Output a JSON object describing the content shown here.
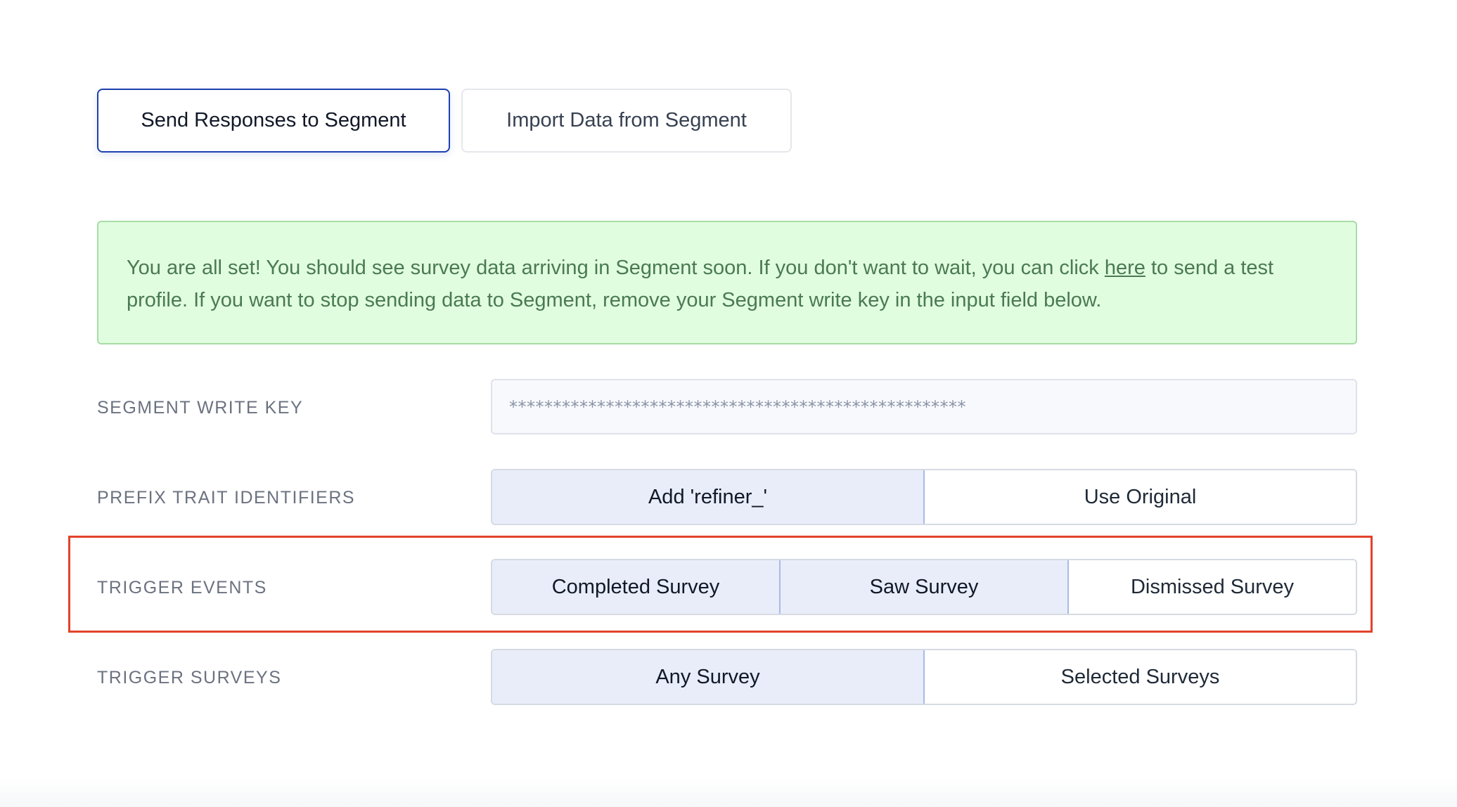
{
  "tabs": [
    {
      "label": "Send Responses to Segment",
      "active": true
    },
    {
      "label": "Import Data from Segment",
      "active": false
    }
  ],
  "alert": {
    "text_before_link": "You are all set! You should see survey data arriving in Segment soon. If you don't want to wait, you can click ",
    "link_label": "here",
    "text_after_link": " to send a test profile. If you want to stop sending data to Segment, remove your Segment write key in the input field below."
  },
  "write_key": {
    "label": "SEGMENT WRITE KEY",
    "value": "****************************************************"
  },
  "prefix_traits": {
    "label": "PREFIX TRAIT IDENTIFIERS",
    "options": [
      "Add 'refiner_'",
      "Use Original"
    ],
    "selected": "Add 'refiner_'"
  },
  "trigger_events": {
    "label": "TRIGGER EVENTS",
    "options": [
      "Completed Survey",
      "Saw Survey",
      "Dismissed Survey"
    ],
    "selected": [
      "Completed Survey",
      "Saw Survey"
    ]
  },
  "trigger_surveys": {
    "label": "TRIGGER SURVEYS",
    "options": [
      "Any Survey",
      "Selected Surveys"
    ],
    "selected": "Any Survey"
  },
  "colors": {
    "accent": "#1e40af",
    "alert_bg": "#e1fde0",
    "alert_text": "#4a7a52",
    "selected_segment_bg": "#e8edf9",
    "highlight": "#e2432c"
  }
}
